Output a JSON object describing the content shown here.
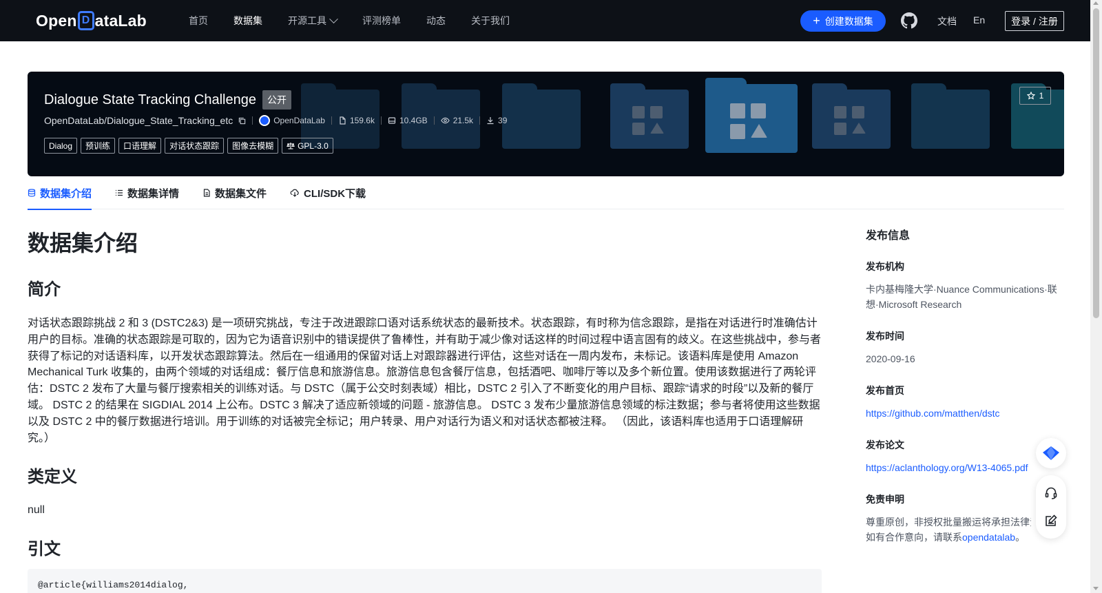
{
  "nav": {
    "logo_text_left": "Open",
    "logo_text_d": "D",
    "logo_text_right": "ataLab",
    "items": [
      {
        "label": "首页"
      },
      {
        "label": "数据集"
      },
      {
        "label": "开源工具"
      },
      {
        "label": "评测榜单"
      },
      {
        "label": "动态"
      },
      {
        "label": "关于我们"
      }
    ],
    "active_index": 1,
    "create_label": "创建数据集",
    "docs_label": "文档",
    "lang_label": "En",
    "login_label": "登录 / 注册",
    "accent": "#1a5cff",
    "bg": "#0d1117"
  },
  "banner": {
    "title": "Dialogue State Tracking Challenge",
    "visibility": "公开",
    "path": "OpenDataLab/Dialogue_State_Tracking_etc",
    "publisher": "OpenDataLab",
    "files": "159.6k",
    "size": "10.4GB",
    "views": "21.5k",
    "downloads": "39",
    "tags": [
      "Dialog",
      "预训练",
      "口语理解",
      "对话状态跟踪",
      "图像去模糊"
    ],
    "license": "GPL-3.0",
    "stars": "1"
  },
  "tabs": [
    {
      "label": "数据集介绍"
    },
    {
      "label": "数据集详情"
    },
    {
      "label": "数据集文件"
    },
    {
      "label": "CLI/SDK下载"
    }
  ],
  "content": {
    "h1": "数据集介绍",
    "intro_heading": "简介",
    "intro_para": "对话状态跟踪挑战 2 和 3 (DSTC2&3) 是一项研究挑战，专注于改进跟踪口语对话系统状态的最新技术。状态跟踪，有时称为信念跟踪，是指在对话进行时准确估计用户的目标。准确的状态跟踪是可取的，因为它为语音识别中的错误提供了鲁棒性，并有助于减少像对话这样的时间过程中语言固有的歧义。在这些挑战中，参与者获得了标记的对话语料库，以开发状态跟踪算法。然后在一组通用的保留对话上对跟踪器进行评估，这些对话在一周内发布，未标记。该语料库是使用 Amazon Mechanical Turk 收集的，由两个领域的对话组成：餐厅信息和旅游信息。旅游信息包含餐厅信息，包括酒吧、咖啡厅等以及多个新位置。使用该数据进行了两轮评估：DSTC 2 发布了大量与餐厅搜索相关的训练对话。与 DSTC（属于公交时刻表域）相比，DSTC 2 引入了不断变化的用户目标、跟踪“请求的时段”以及新的餐厅域。 DSTC 2 的结果在 SIGDIAL 2014 上公布。DSTC 3 解决了适应新领域的问题 - 旅游信息。 DSTC 3 发布少量旅游信息领域的标注数据；参与者将使用这些数据以及 DSTC 2 中的餐厅数据进行培训。用于训练的对话被完全标记；用户转录、用户对话行为语义和对话状态都被注释。 （因此，该语料库也适用于口语理解研究。）",
    "class_heading": "类定义",
    "class_value": "null",
    "cite_heading": "引文",
    "cite_code": "@article{williams2014dialog,"
  },
  "sidebar": {
    "title": "发布信息",
    "org_label": "发布机构",
    "org_value": "卡内基梅隆大学·Nuance Communications·联想·Microsoft Research",
    "date_label": "发布时间",
    "date_value": "2020-09-16",
    "home_label": "发布首页",
    "home_value": "https://github.com/matthen/dstc",
    "paper_label": "发布论文",
    "paper_value": "https://aclanthology.org/W13-4065.pdf",
    "disclaimer_label": "免责申明",
    "disclaimer_line1": "尊重原创，非授权批量搬运将承担法律责",
    "disclaimer_line2_pre": "如有合作意向，请联系",
    "disclaimer_link": "opendatalab",
    "disclaimer_line2_post": "。"
  }
}
